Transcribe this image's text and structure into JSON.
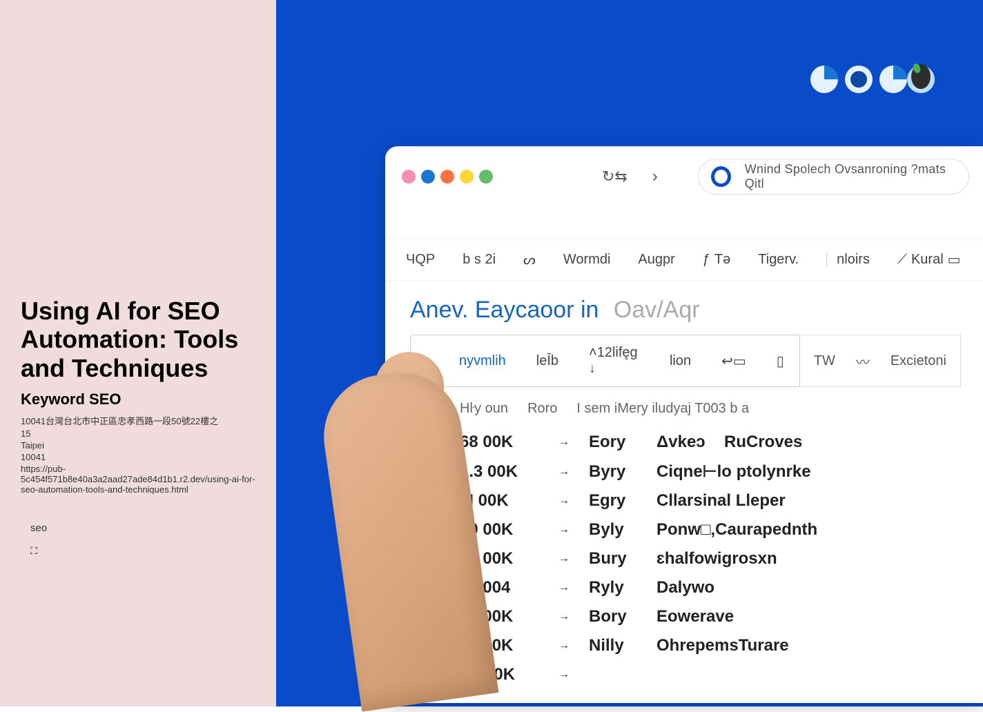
{
  "left": {
    "title": "Using AI for SEO Automation: Tools and Techniques",
    "subtitle": "Keyword SEO",
    "line1": "10041台灣台北市中正區忠孝西路一段50號22樓之",
    "line2": "15",
    "line3": "Taipei",
    "line4": "10041",
    "line5": "https://pub-5c454f571b8e40a3a2aad27ade84d1b1.r2.dev/using-ai-for-seo-automation-tools-and-techniques.html",
    "seo_label": "seo"
  },
  "search": {
    "text": "Wnind Spolech Ovsanroning ?mats Qitl"
  },
  "tabs": [
    "ЧQP",
    "b s 2i",
    "Wormdi",
    "Augpr",
    "Tə",
    "Tigerv.",
    "nloirs",
    "Kural"
  ],
  "heading": {
    "blue": "Anev. Еaycaoor in",
    "gray": "Oav/Aqr"
  },
  "filters": {
    "first": "nyvmlih",
    "second": "leĪb",
    "third": "˄12lifęg ↓",
    "fourth": "lion",
    "side1": "TW",
    "side2": "Excietoni"
  },
  "subheader": {
    "c1": "Hŀy oun",
    "c2": "Roro",
    "c3": "I sem iMery iludyaj T003 b a"
  },
  "rows": [
    {
      "count": "68 00K",
      "mid": "Eory",
      "mid2": "Δvkeɔ",
      "desc": "RuCroves"
    },
    {
      "count": "1.3 00K",
      "mid": "Byry",
      "mid2": "",
      "desc": "Ciqne⊢lo ptolynrke"
    },
    {
      "count": "8I 00K",
      "mid": "Egry",
      "mid2": "",
      "desc": "Cllarsinal Lleper"
    },
    {
      "count": "80 00K",
      "mid": "Byly",
      "mid2": "",
      "desc": "Ponw□‚Caurapednth"
    },
    {
      "count": "32 00K",
      "mid": "Bury",
      "mid2": "",
      "desc": "ɛhalfowigrosxn"
    },
    {
      "count": "17 004",
      "mid": "Ryly",
      "mid2": "",
      "desc": "Dalywo"
    },
    {
      "count": "32 00K",
      "mid": "Bory",
      "mid2": "",
      "desc": "Eowerave"
    },
    {
      "count": "80 00K",
      "mid": "Nilly",
      "mid2": "",
      "desc": "OhrepemsTurare"
    },
    {
      "count": "8E 00K",
      "mid": "",
      "mid2": "",
      "desc": ""
    }
  ]
}
